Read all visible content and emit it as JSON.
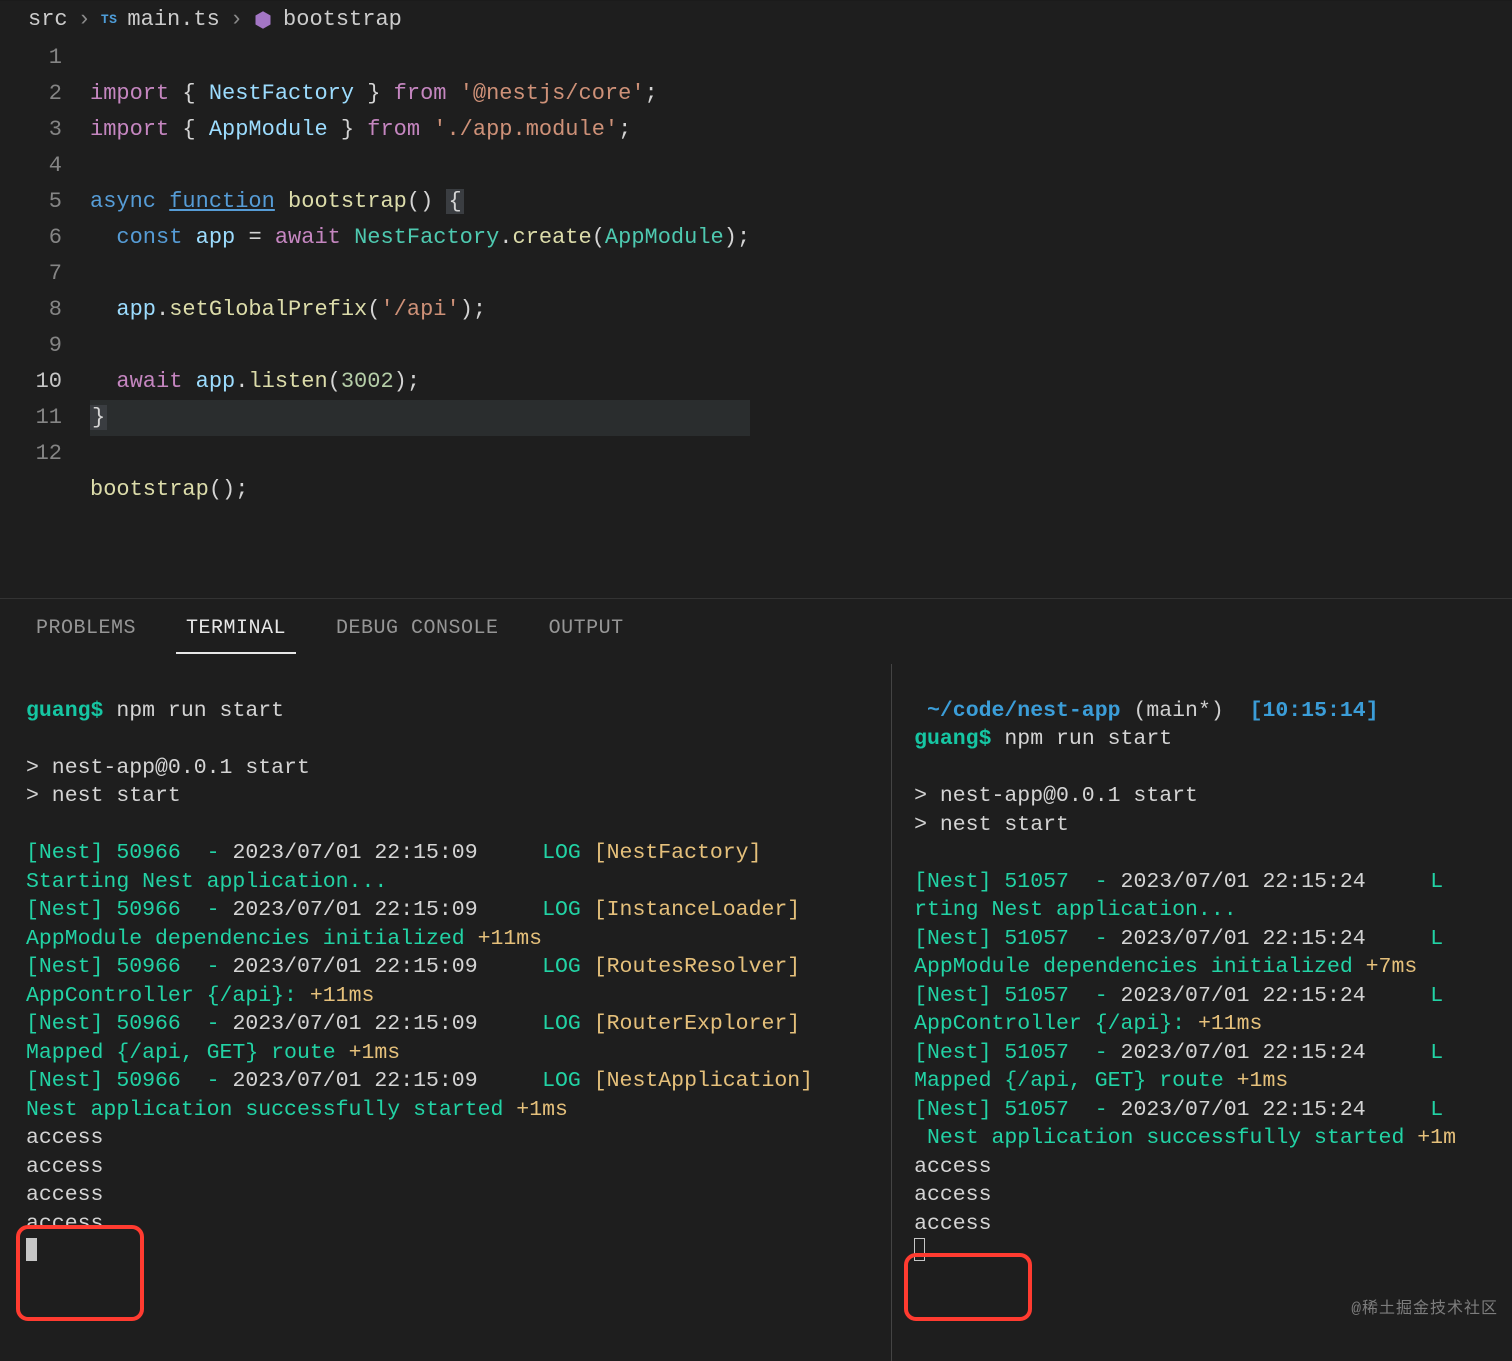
{
  "breadcrumbs": {
    "root": "src",
    "file": "main.ts",
    "symbol": "bootstrap",
    "file_lang": "TS"
  },
  "editor": {
    "line_numbers": [
      "1",
      "2",
      "3",
      "4",
      "5",
      "6",
      "7",
      "8",
      "9",
      "10",
      "11",
      "12"
    ],
    "tokens": {
      "l1_import": "import",
      "l1_brace_open": "{ ",
      "l1_nestfactory": "NestFactory",
      "l1_brace_close": " }",
      "l1_from": "from",
      "l1_pkg": "'@nestjs/core'",
      "l1_semi": ";",
      "l2_import": "import",
      "l2_brace_open": "{ ",
      "l2_appmodule": "AppModule",
      "l2_brace_close": " }",
      "l2_from": "from",
      "l2_path": "'./app.module'",
      "l2_semi": ";",
      "l4_async": "async",
      "l4_function": "function",
      "l4_name": "bootstrap",
      "l4_parens": "()",
      "l4_brace": "{",
      "l5_const": "const",
      "l5_app": "app",
      "l5_eq": "=",
      "l5_await": "await",
      "l5_factory": "NestFactory",
      "l5_dot": ".",
      "l5_create": "create",
      "l5_open": "(",
      "l5_mod": "AppModule",
      "l5_close": ");",
      "l7_app": "app",
      "l7_dot": ".",
      "l7_method": "setGlobalPrefix",
      "l7_open": "(",
      "l7_str": "'/api'",
      "l7_close": ");",
      "l9_await": "await",
      "l9_app": "app",
      "l9_dot": ".",
      "l9_listen": "listen",
      "l9_open": "(",
      "l9_port": "3002",
      "l9_close": ");",
      "l10_brace": "}",
      "l11_call": "bootstrap",
      "l11_semi": "();"
    }
  },
  "panel": {
    "tabs": [
      "PROBLEMS",
      "TERMINAL",
      "DEBUG CONSOLE",
      "OUTPUT"
    ],
    "active_tab_index": 1
  },
  "term_left": {
    "prompt_user": "guang$",
    "prompt_cmd": "npm run start",
    "start_banner1": "> nest-app@0.0.1 start",
    "start_banner2": "> nest start",
    "pid": "50966",
    "ts": "2023/07/01 22:15:09",
    "lines": [
      {
        "ctx": "[NestFactory]",
        "msg": "Starting Nest application...",
        "delta": ""
      },
      {
        "ctx": "[InstanceLoader]",
        "msg": "AppModule dependencies initialized",
        "delta": "+11ms"
      },
      {
        "ctx": "[RoutesResolver]",
        "msg": "AppController {/api}:",
        "delta": "+11ms"
      },
      {
        "ctx": "[RouterExplorer]",
        "msg": "Mapped {/api, GET} route",
        "delta": "+1ms"
      },
      {
        "ctx": "[NestApplication]",
        "msg": " Nest application successfully started",
        "delta": "+1ms"
      }
    ],
    "access": [
      "access",
      "access",
      "access",
      "access"
    ]
  },
  "term_right": {
    "cwd": "~/code/nest-app",
    "branch": "(main*)",
    "clock": "[10:15:14]",
    "prompt_user": "guang$",
    "prompt_cmd": "npm run start",
    "start_banner1": "> nest-app@0.0.1 start",
    "start_banner2": "> nest start",
    "pid": "51057",
    "ts": "2023/07/01 22:15:24",
    "lines": [
      {
        "ctx": "",
        "msg": "rting Nest application...",
        "delta": ""
      },
      {
        "ctx": "",
        "msg": "AppModule dependencies initialized",
        "delta": "+7ms"
      },
      {
        "ctx": "",
        "msg": "AppController {/api}:",
        "delta": "+11ms"
      },
      {
        "ctx": "",
        "msg": "Mapped {/api, GET} route",
        "delta": "+1ms"
      },
      {
        "ctx": "",
        "msg": " Nest application successfully started",
        "delta": "+1m"
      }
    ],
    "access": [
      "access",
      "access",
      "access"
    ]
  },
  "watermark": "@稀土掘金技术社区",
  "colors": {
    "accent_green": "#22d3a5",
    "accent_yellow": "#e5c07b",
    "accent_red": "#ff3b30"
  }
}
